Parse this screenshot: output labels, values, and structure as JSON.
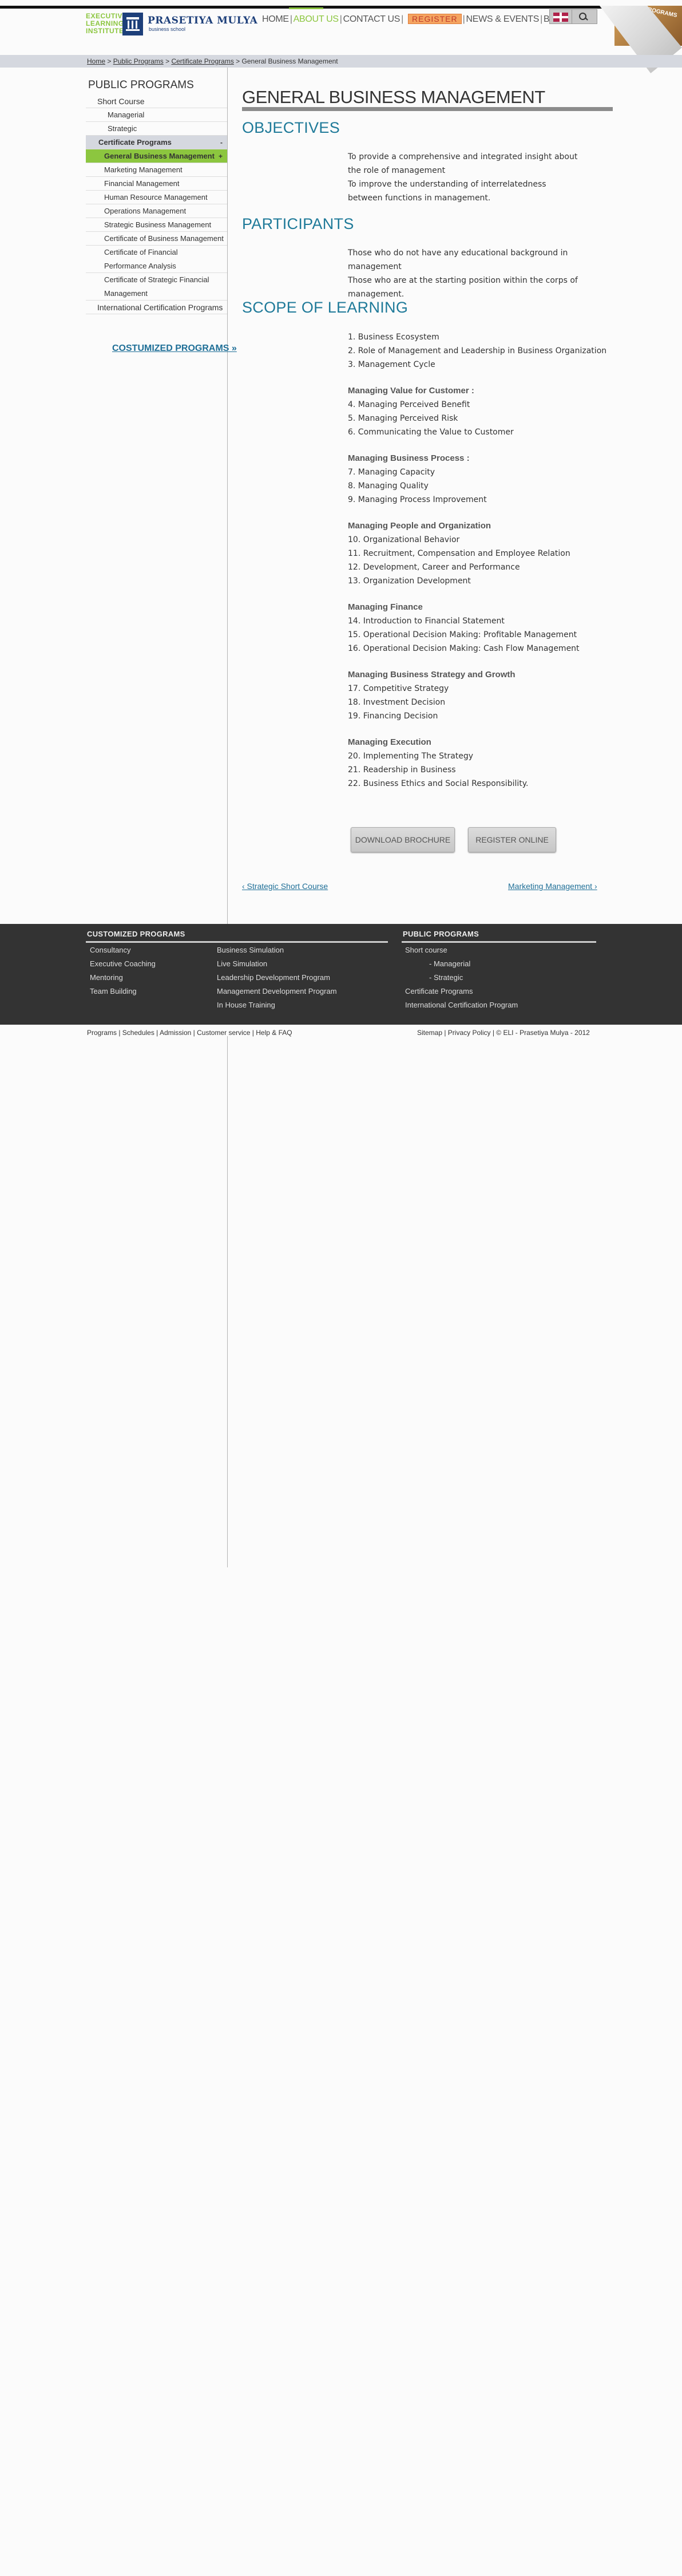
{
  "header": {
    "logo_eli_lines": [
      "EXECUTIVE",
      "LEARNING",
      "INSTITUTE"
    ],
    "logo_pm_name": "PRASETIYA MULYA",
    "logo_pm_sub": "business school",
    "nav": [
      "HOME",
      "ABOUT US",
      "CONTACT US",
      "REGISTER",
      "NEWS & EVENTS",
      "BLOG"
    ],
    "curl_text": "PROGRAMS"
  },
  "breadcrumb": {
    "items": [
      "Home",
      "Public Programs",
      "Certificate Programs",
      "General Business Management"
    ],
    "separator": ">"
  },
  "sidebar": {
    "title": "PUBLIC PROGRAMS",
    "items": [
      {
        "label": "Short Course"
      },
      {
        "label": "Managerial"
      },
      {
        "label": "Strategic"
      },
      {
        "label": "Certificate Programs",
        "arrow": "-"
      },
      {
        "label": "General Business Management",
        "arrow": "+"
      },
      {
        "label": "Marketing Management"
      },
      {
        "label": "Financial Management"
      },
      {
        "label": "Human Resource Management"
      },
      {
        "label": "Operations Management"
      },
      {
        "label": "Strategic Business Management"
      },
      {
        "label": "Certificate of Business Management"
      },
      {
        "label": "Certificate of Financial Performance Analysis"
      },
      {
        "label": "Certificate of Strategic Financial Management"
      },
      {
        "label": "International Certification Programs"
      }
    ],
    "customized_link": "COSTUMIZED PROGRAMS »"
  },
  "main": {
    "title": "GENERAL BUSINESS MANAGEMENT",
    "objectives_heading": "OBJECTIVES",
    "objectives_text": [
      "To provide a comprehensive and integrated insight about the role of management",
      "To improve the understanding of interrelatedness between functions in management."
    ],
    "participants_heading": "PARTICIPANTS",
    "participants_text": [
      "Those who do not have any educational background in management",
      "Those who are at the starting position within the corps of management."
    ],
    "scope_heading": "SCOPE OF LEARNING",
    "scope_groups": [
      {
        "heading": "",
        "items": [
          "1.  Business Ecosystem",
          "2.  Role of Management and Leadership in Business Organization",
          "3.  Management Cycle"
        ]
      },
      {
        "heading": "Managing Value for Customer :",
        "items": [
          "4.  Managing Perceived Benefit",
          "5.  Managing Perceived Risk",
          "6.  Communicating the Value to Customer"
        ]
      },
      {
        "heading": "Managing Business Process :",
        "items": [
          "7.  Managing Capacity",
          "8.  Managing Quality",
          "9.  Managing Process Improvement"
        ]
      },
      {
        "heading": "Managing People and Organization",
        "items": [
          "10.  Organizational Behavior",
          "11.  Recruitment, Compensation and Employee Relation",
          "12.  Development, Career and Performance",
          "13.  Organization Development"
        ]
      },
      {
        "heading": "Managing Finance",
        "items": [
          "14.  Introduction to Financial Statement",
          "15.  Operational Decision Making: Profitable Management",
          "16.  Operational Decision Making: Cash Flow Management"
        ]
      },
      {
        "heading": "Managing Business Strategy and Growth",
        "items": [
          "17.  Competitive Strategy",
          "18.  Investment Decision",
          "19.  Financing Decision"
        ]
      },
      {
        "heading": "Managing Execution",
        "items": [
          "20.  Implementing The Strategy",
          "21.  Readership in Business",
          "22.  Business Ethics and Social Responsibility."
        ]
      }
    ],
    "download_button": "DOWNLOAD BROCHURE",
    "register_button": "REGISTER ONLINE",
    "prev_link": "‹ Strategic Short Course",
    "next_link": "Marketing Management ›"
  },
  "footer": {
    "customized_heading": "CUSTOMIZED PROGRAMS",
    "customized_col1": [
      "Consultancy",
      "Executive Coaching",
      "Mentoring",
      "Team Building"
    ],
    "customized_col2": [
      "Business Simulation",
      "Live Simulation",
      "Leadership Development Program",
      "Management Development Program",
      "In House Training"
    ],
    "public_heading": "PUBLIC PROGRAMS",
    "public_items": [
      "Short course",
      "- Managerial",
      "- Strategic",
      "Certificate Programs",
      "International Certification Program"
    ],
    "bottom_left": "Programs | Schedules | Admission | Customer service | Help & FAQ",
    "bottom_right": "Sitemap | Privacy Policy | © ELI - Prasetiya Mulya - 2012"
  },
  "colors": {
    "accent_green": "#8cc63f",
    "heading_blue": "#1f7a99",
    "brand_navy": "#1d3f7a",
    "footer_bg": "#333333"
  }
}
